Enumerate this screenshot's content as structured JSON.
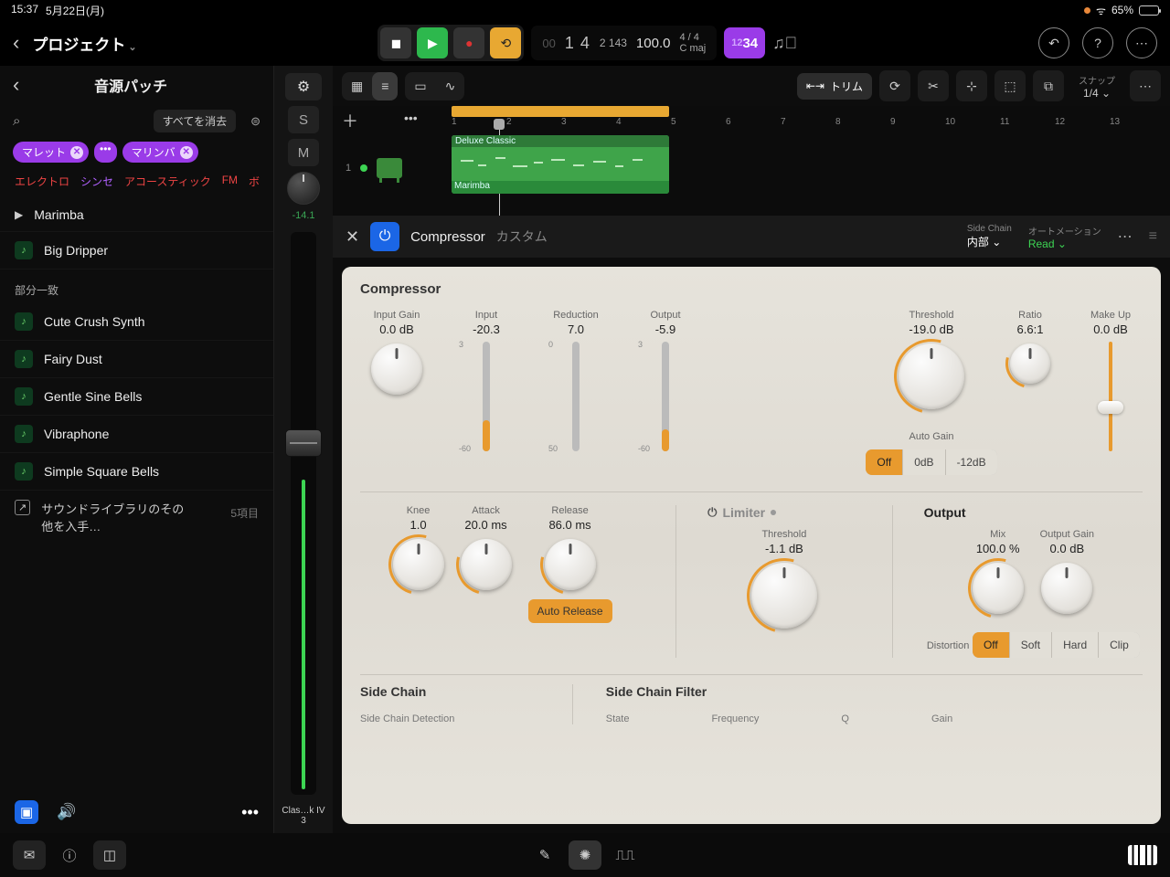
{
  "status": {
    "time": "15:37",
    "date": "5月22日(月)",
    "battery": "65%"
  },
  "top": {
    "project": "プロジェクト",
    "position": "1 4",
    "sub_pos": "2 143",
    "tempo": "100.0",
    "sig": "4 / 4",
    "key": "C maj",
    "count_in": "1234"
  },
  "sidebar": {
    "title": "音源パッチ",
    "clear_all": "すべてを消去",
    "tags": [
      {
        "label": "マレット",
        "has_close": true,
        "has_dots": true
      },
      {
        "label": "マリンバ",
        "has_close": true,
        "has_dots": false
      }
    ],
    "categories": [
      "エレクトロ",
      "シンセ",
      "アコースティック",
      "FM",
      "ボ"
    ],
    "featured": [
      "Marimba",
      "Big Dripper"
    ],
    "partial_label": "部分一致",
    "items": [
      "Cute Crush Synth",
      "Fairy Dust",
      "Gentle Sine Bells",
      "Vibraphone",
      "Simple Square Bells"
    ],
    "library_more": "サウンドライブラリのその他を入手…",
    "library_count": "5項目"
  },
  "channel": {
    "db": "-14.1",
    "track_name_top": "Clas…k IV",
    "track_name_bot": "3"
  },
  "toolbar": {
    "trim": "トリム",
    "snap_label": "スナップ",
    "snap_value": "1/4"
  },
  "timeline": {
    "bars": [
      "1",
      "2",
      "3",
      "4",
      "5",
      "6",
      "7",
      "8",
      "9",
      "10",
      "11",
      "12",
      "13"
    ],
    "track_num": "1",
    "region_name": "Deluxe Classic",
    "region_sub": "Marimba"
  },
  "plugin": {
    "name": "Compressor",
    "preset": "カスタム",
    "sidechain_label": "Side Chain",
    "sidechain_value": "内部",
    "automation_label": "オートメーション",
    "automation_value": "Read",
    "body_title": "Compressor",
    "row1": {
      "input_gain": {
        "label": "Input Gain",
        "value": "0.0 dB"
      },
      "input": {
        "label": "Input",
        "value": "-20.3",
        "top": "3",
        "bot": "-60"
      },
      "reduction": {
        "label": "Reduction",
        "value": "7.0",
        "top": "0",
        "bot": "50"
      },
      "output": {
        "label": "Output",
        "value": "-5.9",
        "top": "3",
        "bot": "-60"
      },
      "threshold": {
        "label": "Threshold",
        "value": "-19.0 dB"
      },
      "ratio": {
        "label": "Ratio",
        "value": "6.6:1"
      },
      "makeup": {
        "label": "Make Up",
        "value": "0.0 dB"
      },
      "autogain": {
        "label": "Auto Gain",
        "options": [
          "Off",
          "0dB",
          "-12dB"
        ]
      }
    },
    "row2": {
      "knee": {
        "label": "Knee",
        "value": "1.0"
      },
      "attack": {
        "label": "Attack",
        "value": "20.0 ms"
      },
      "release": {
        "label": "Release",
        "value": "86.0 ms"
      },
      "auto_release": "Auto Release",
      "limiter_title": "Limiter",
      "limiter_threshold": {
        "label": "Threshold",
        "value": "-1.1 dB"
      },
      "output_title": "Output",
      "mix": {
        "label": "Mix",
        "value": "100.0 %"
      },
      "output_gain": {
        "label": "Output Gain",
        "value": "0.0 dB"
      },
      "distortion_label": "Distortion",
      "distortion_options": [
        "Off",
        "Soft",
        "Hard",
        "Clip"
      ]
    },
    "sidechain": {
      "sc_title": "Side Chain",
      "scf_title": "Side Chain Filter",
      "detection": "Side Chain Detection",
      "state": "State",
      "frequency": "Frequency",
      "q": "Q",
      "gain": "Gain"
    }
  }
}
